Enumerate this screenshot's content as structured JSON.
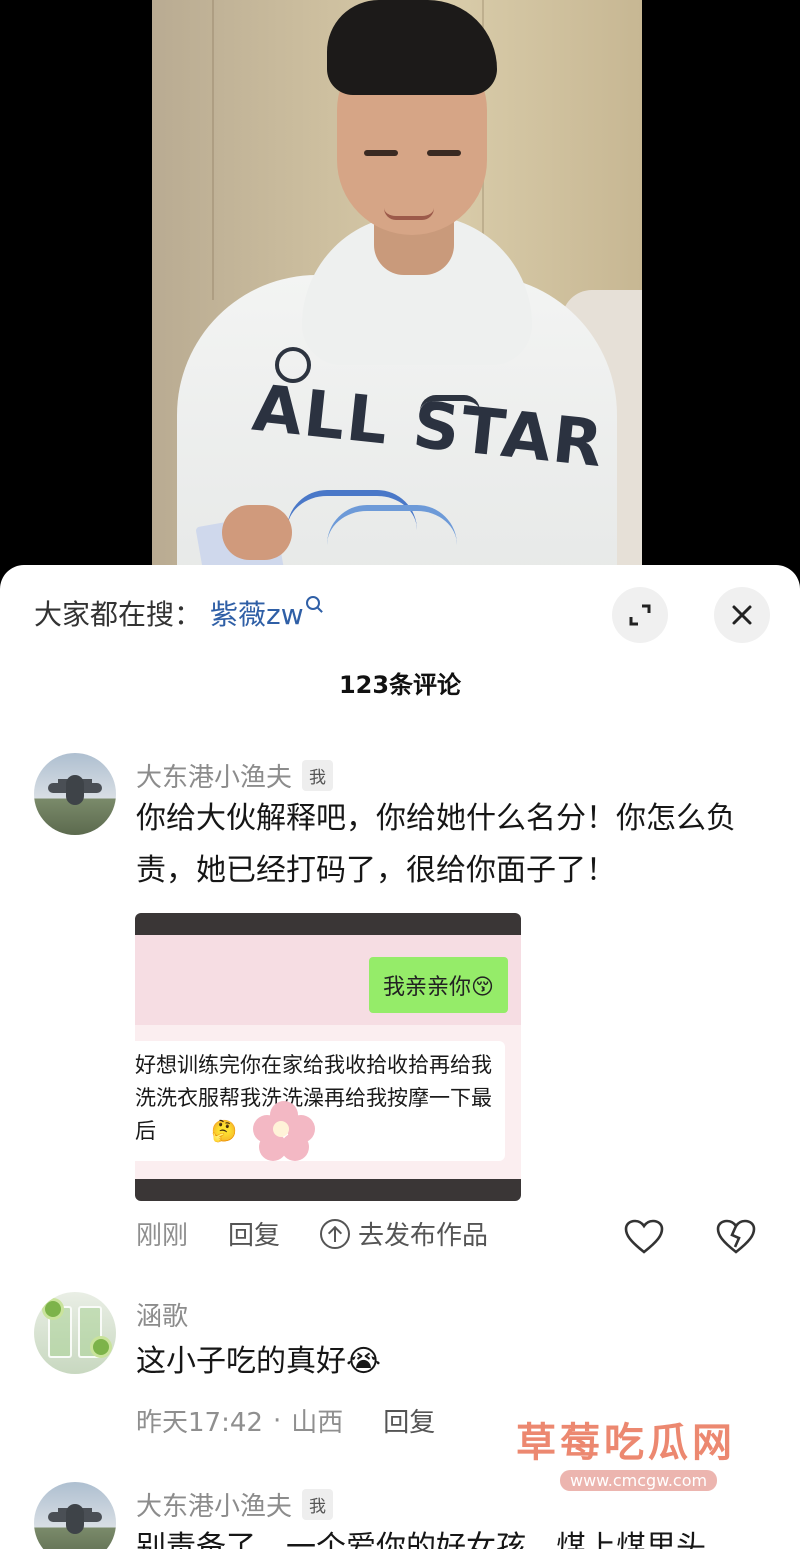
{
  "video": {
    "shirt_text": "ALL STAR"
  },
  "sheet": {
    "search_label": "大家都在搜：",
    "search_term": "紫薇zw",
    "comment_count": "123条评论"
  },
  "comments": [
    {
      "user": "大东港小渔夫",
      "badge": "我",
      "text": "你给大伙解释吧，你给她什么名分！你怎么负责，她已经打码了，很给你面子了！",
      "image": {
        "green_bubble": "我亲亲你😚",
        "white_bubble": "好想训练完你在家给我收拾收拾再给我洗洗衣服帮我洗洗澡再给我按摩一下最后 　 　🤔"
      },
      "time": "刚刚",
      "reply": "回复",
      "publish": "去发布作品"
    },
    {
      "user": "涵歌",
      "text": "这小子吃的真好😭",
      "time": "昨天17:42",
      "separator": "·",
      "location": "山西",
      "reply": "回复"
    },
    {
      "user": "大东港小渔夫",
      "badge": "我",
      "text": "别责备了，一个爱你的好女孩，煤上煤里头"
    }
  ],
  "watermark": {
    "title": "草莓吃瓜网",
    "url": "www.cmcgw.com"
  },
  "colors": {
    "search_term": "#2f5fa6",
    "wechat_green": "#95ec69",
    "watermark": "#e86e50"
  }
}
